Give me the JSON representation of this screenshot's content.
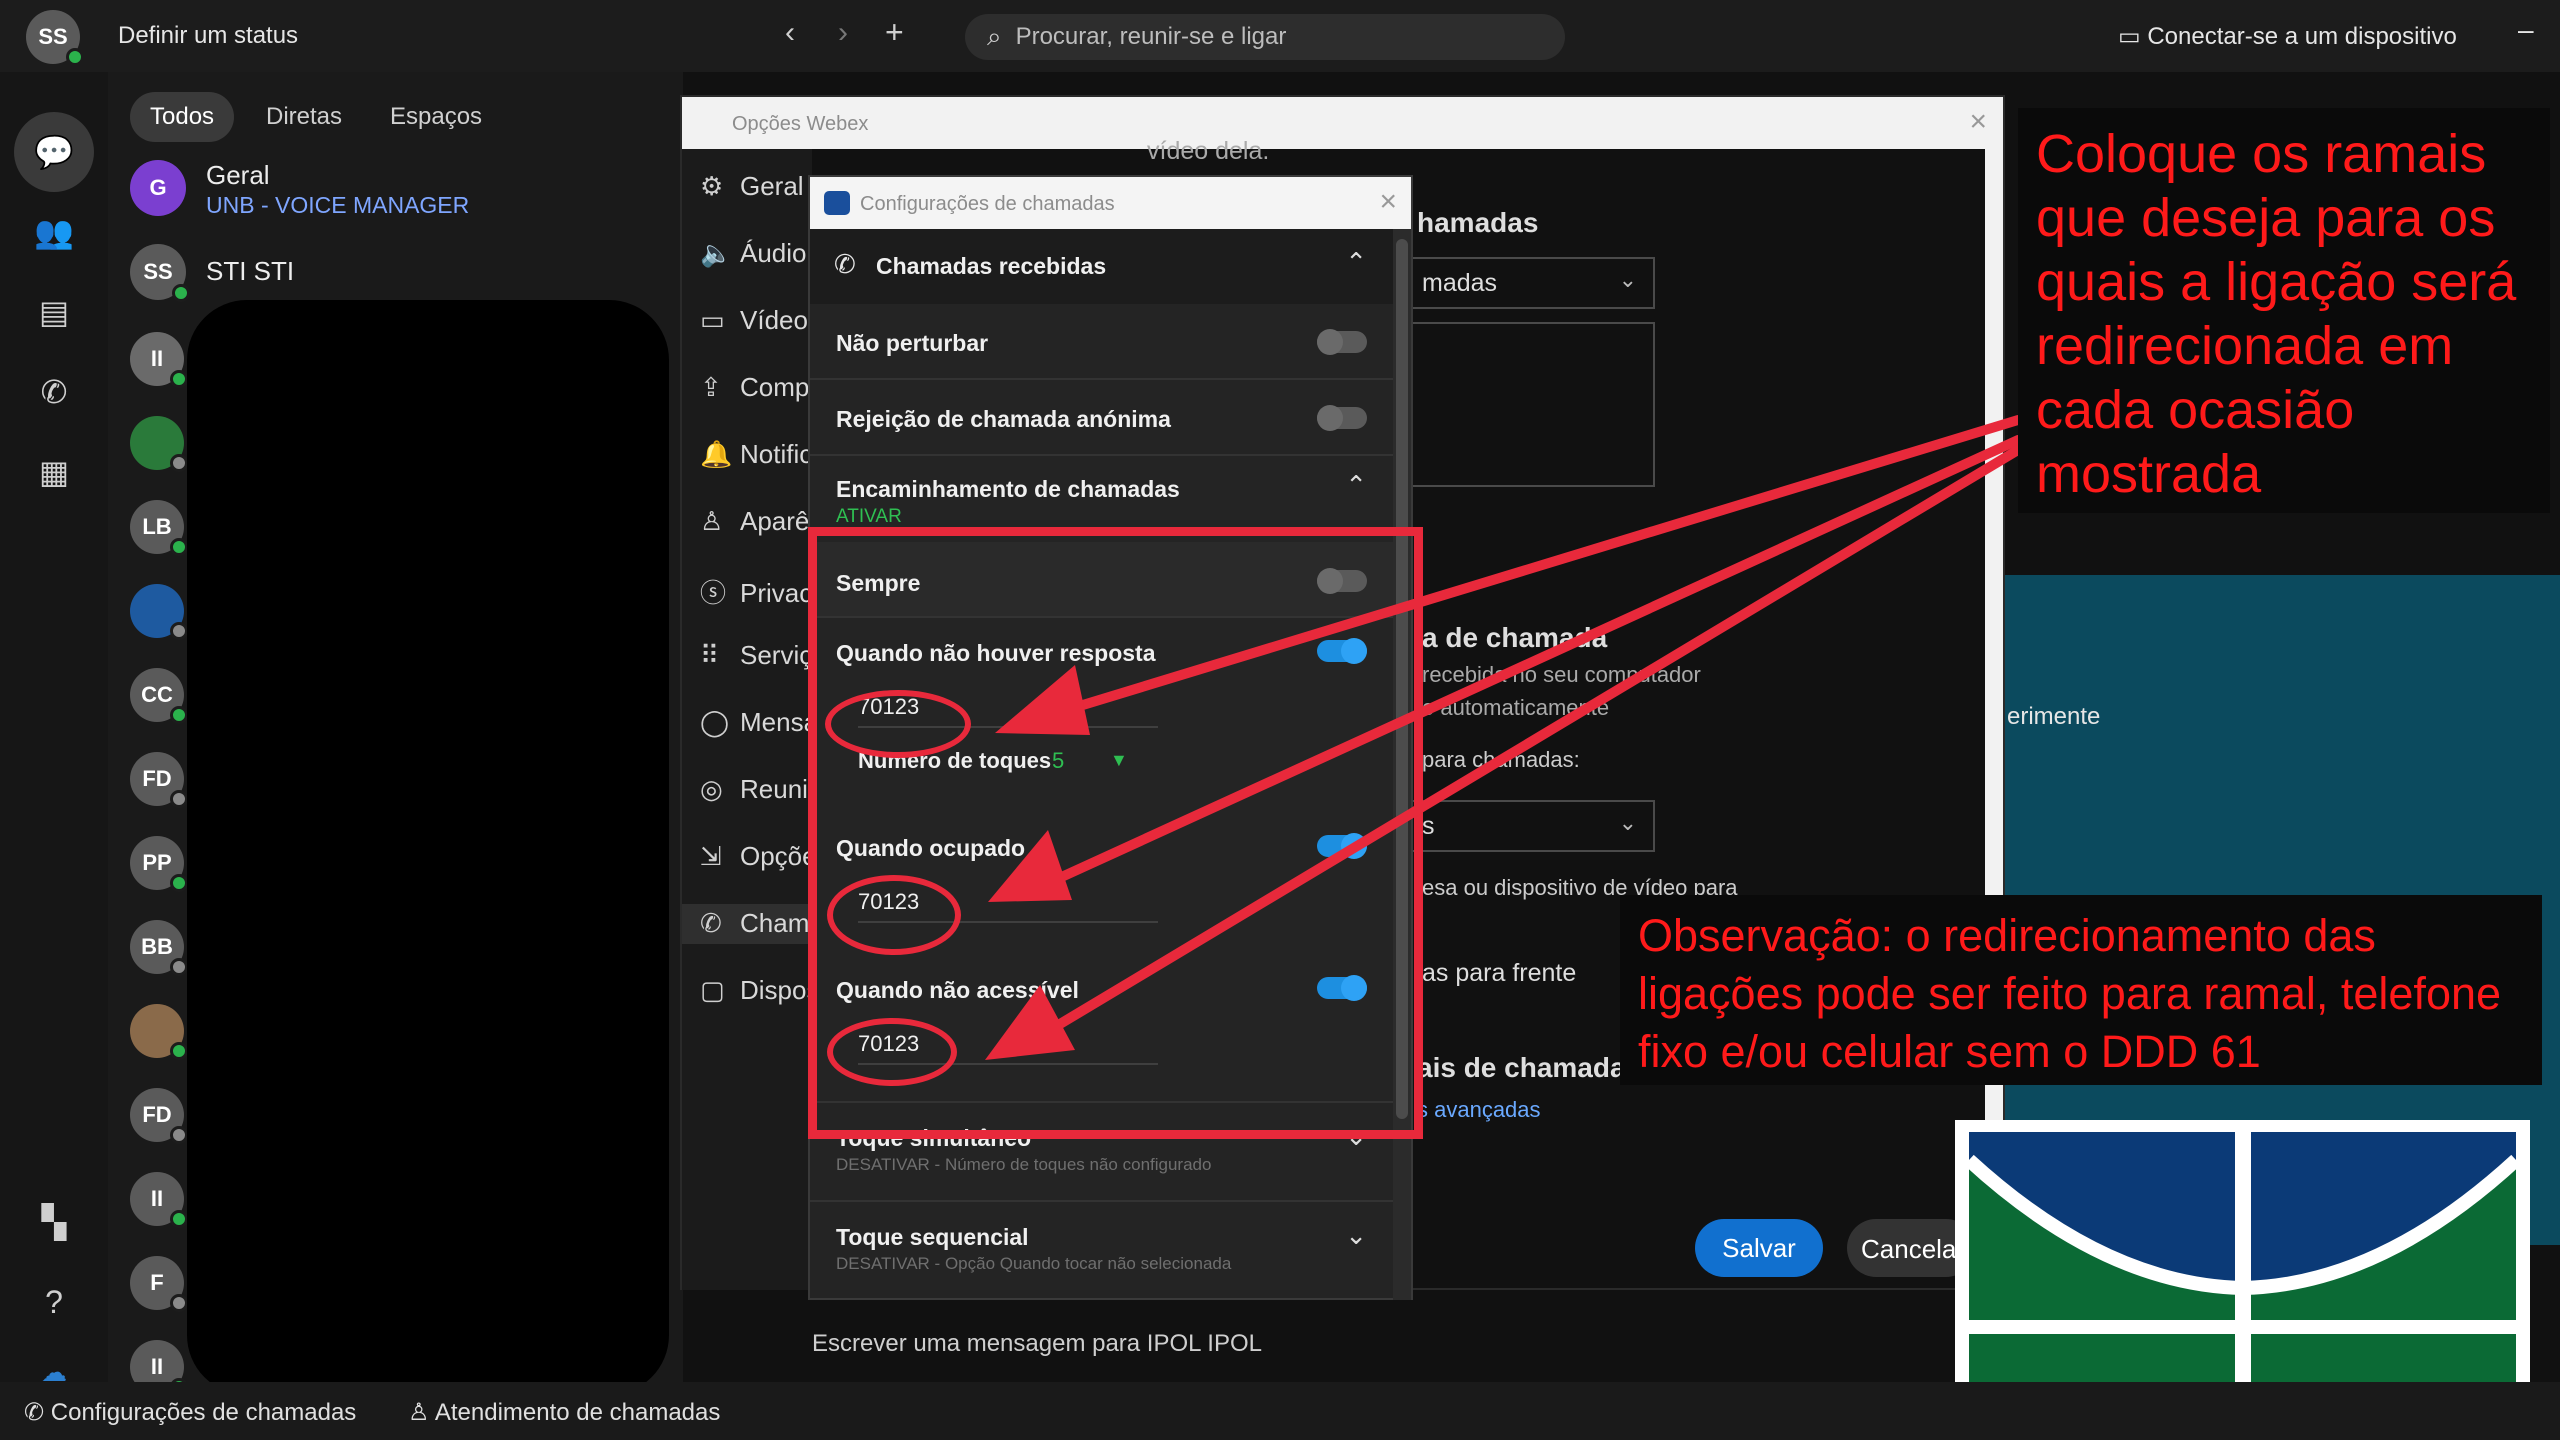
{
  "topbar": {
    "user_initials": "SS",
    "status_text": "Definir um status",
    "search_placeholder": "Procurar, reunir-se e ligar",
    "connect_device": "Conectar-se a um dispositivo"
  },
  "filters": [
    "Todos",
    "Diretas",
    "Espaços"
  ],
  "conversations": [
    {
      "initials": "G",
      "name": "Geral",
      "sub": "UNB - VOICE MANAGER"
    },
    {
      "initials": "SS",
      "name": "STI STI",
      "sub": ""
    }
  ],
  "contacts_initials": [
    "II",
    "",
    "LB",
    "",
    "CC",
    "FD",
    "PP",
    "BB",
    "",
    "FD",
    "II",
    "F",
    "II"
  ],
  "options_window": {
    "title": "Opções Webex",
    "nav": [
      {
        "icon": "⚙",
        "label": "Geral"
      },
      {
        "icon": "🔈",
        "label": "Áudio"
      },
      {
        "icon": "▭",
        "label": "Vídeo"
      },
      {
        "icon": "⇪",
        "label": "Compartilhamento"
      },
      {
        "icon": "🔔",
        "label": "Notificações"
      },
      {
        "icon": "♙",
        "label": "Aparência"
      },
      {
        "icon": "ⓢ",
        "label": "Privacidade"
      },
      {
        "icon": "⠿",
        "label": "Serviços"
      },
      {
        "icon": "◯",
        "label": "Mensagens"
      },
      {
        "icon": "◎",
        "label": "Reuniões"
      },
      {
        "icon": "⇲",
        "label": "Opções"
      },
      {
        "icon": "✆",
        "label": "Chamadas"
      },
      {
        "icon": "▢",
        "label": "Dispositivos"
      }
    ],
    "right": {
      "video_text": "vídeo dela.",
      "section_title": "hamadas",
      "dropdown1": "madas",
      "section2_title": "a de chamada",
      "section2_text1": "recebida no seu computador",
      "section2_text2": "o automaticamente",
      "section2_text3": "para chamadas:",
      "desk_text": "esa ou dispositivo de vídeo para",
      "dropdown3": "as para frente",
      "section3_title": "ais de chamadas",
      "advanced_link": "s avançadas",
      "teal_text": "erimente",
      "save": "Salvar",
      "cancel": "Cancelar"
    }
  },
  "call_dialog": {
    "title": "Configurações de chamadas",
    "incoming_header": "Chamadas recebidas",
    "dnd": "Não perturbar",
    "anon_reject": "Rejeição de chamada anónima",
    "forwarding": "Encaminhamento de chamadas",
    "forwarding_state": "ATIVAR",
    "always": "Sempre",
    "no_answer": "Quando não houver resposta",
    "no_answer_ext": "70123",
    "rings_label": "Número de toques",
    "rings_value": "5",
    "busy": "Quando ocupado",
    "busy_ext": "70123",
    "unreachable": "Quando não acessível",
    "unreachable_ext": "70123",
    "simultaneous": "Toque simultâneo",
    "simultaneous_sub": "DESATIVAR - Número de toques não configurado",
    "sequential": "Toque sequencial",
    "sequential_sub": "DESATIVAR - Opção Quando tocar não selecionada"
  },
  "message_placeholder": "Escrever uma mensagem para IPOL IPOL",
  "statusbar": {
    "call_settings": "Configurações de chamadas",
    "call_handling": "Atendimento de chamadas"
  },
  "annotations": {
    "note1": "Coloque os ramais que deseja para os quais a ligação será redirecionada em cada ocasião mostrada",
    "note2": "Observação: o redirecionamento das ligações pode ser feito para ramal, telefone fixo e/ou celular sem o DDD 61"
  },
  "colors": {
    "accent_blue": "#1170cf",
    "annotation_red": "#e8293b",
    "presence_green": "#2bb24c",
    "unb_blue": "#0b3a77",
    "unb_green": "#0b6a35"
  }
}
